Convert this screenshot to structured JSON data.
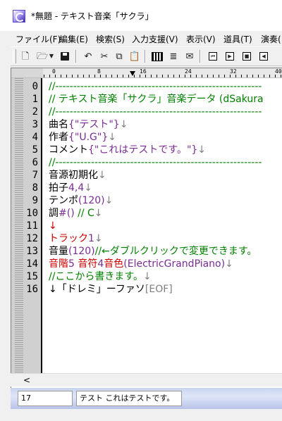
{
  "window": {
    "title": "*無題 - テキスト音楽「サクラ」"
  },
  "menu": [
    "ファイル(F)",
    "編集(E)",
    "検索(S)",
    "入力支援(V)",
    "表示(V)",
    "道具(T)",
    "演奏("
  ],
  "toolbar_icons": [
    "new-file-icon",
    "open-folder-icon",
    "dropdown-arrow-icon",
    "save-icon",
    "undo-icon",
    "cut-icon",
    "copy-icon",
    "paste-icon",
    "piano-keyboard-icon",
    "list-edit-icon",
    "mail-icon",
    "play-start-icon",
    "play-icon",
    "stop-icon",
    "rewind-icon"
  ],
  "ruler": {
    "labels": [
      "0",
      "8",
      "16",
      "24",
      "32",
      "40"
    ]
  },
  "editor": {
    "line_numbers": [
      "0",
      "1",
      "2",
      "3",
      "4",
      "5",
      "6",
      "7",
      "8",
      "9",
      "10",
      "11",
      "12",
      "13",
      "14",
      "15",
      "16"
    ],
    "lines": [
      [
        {
          "t": "//----------------------------------------------------------",
          "c": "green"
        }
      ],
      [
        {
          "t": "// テキスト音楽「サクラ」音楽データ (dSakura",
          "c": "green"
        }
      ],
      [
        {
          "t": "//----------------------------------------------------------",
          "c": "green"
        }
      ],
      [
        {
          "t": "曲名",
          "c": "black"
        },
        {
          "t": "{\"テスト\"}",
          "c": "purple"
        },
        {
          "t": "↓",
          "c": "gray"
        }
      ],
      [
        {
          "t": "作者",
          "c": "black"
        },
        {
          "t": "{\"U.G\"}",
          "c": "purple"
        },
        {
          "t": "↓",
          "c": "gray"
        }
      ],
      [
        {
          "t": "コメント",
          "c": "black"
        },
        {
          "t": "{\"これはテストです。\"}",
          "c": "purple"
        },
        {
          "t": "↓",
          "c": "gray"
        }
      ],
      [
        {
          "t": "//----------------------------------------------------------",
          "c": "green"
        }
      ],
      [
        {
          "t": "音源初期化",
          "c": "black"
        },
        {
          "t": "↓",
          "c": "gray"
        }
      ],
      [
        {
          "t": "拍子",
          "c": "black"
        },
        {
          "t": "4,4",
          "c": "purple"
        },
        {
          "t": "↓",
          "c": "gray"
        }
      ],
      [
        {
          "t": "テンポ",
          "c": "black"
        },
        {
          "t": "(120)",
          "c": "purple"
        },
        {
          "t": "↓",
          "c": "gray"
        }
      ],
      [
        {
          "t": "調",
          "c": "black"
        },
        {
          "t": "#()",
          "c": "purple"
        },
        {
          "t": "            // C",
          "c": "green"
        },
        {
          "t": "↓",
          "c": "gray"
        }
      ],
      [
        {
          "t": "↓",
          "c": "red"
        }
      ],
      [
        {
          "t": "トラック",
          "c": "red"
        },
        {
          "t": "1",
          "c": "purple"
        },
        {
          "t": "↓",
          "c": "gray"
        }
      ],
      [
        {
          "t": "音量",
          "c": "black"
        },
        {
          "t": "(120)",
          "c": "purple"
        },
        {
          "t": "//←ダブルクリックで変更できます。",
          "c": "green"
        }
      ],
      [
        {
          "t": "音階",
          "c": "red"
        },
        {
          "t": "5 ",
          "c": "purple"
        },
        {
          "t": "音符",
          "c": "red"
        },
        {
          "t": "4",
          "c": "purple"
        },
        {
          "t": "音色",
          "c": "red"
        },
        {
          "t": "(ElectricGrandPiano)",
          "c": "purple"
        },
        {
          "t": "↓",
          "c": "gray"
        }
      ],
      [
        {
          "t": "//ここから書きます。",
          "c": "green"
        },
        {
          "t": "↓",
          "c": "gray"
        }
      ],
      [
        {
          "t": "↓「ドレミ」ーファソ",
          "c": "black"
        },
        {
          "t": "[EOF]",
          "c": "gray"
        }
      ]
    ]
  },
  "scrollbar": {
    "left_arrow": "<"
  },
  "status": {
    "line": "17",
    "message": "テスト これはテストです。"
  }
}
